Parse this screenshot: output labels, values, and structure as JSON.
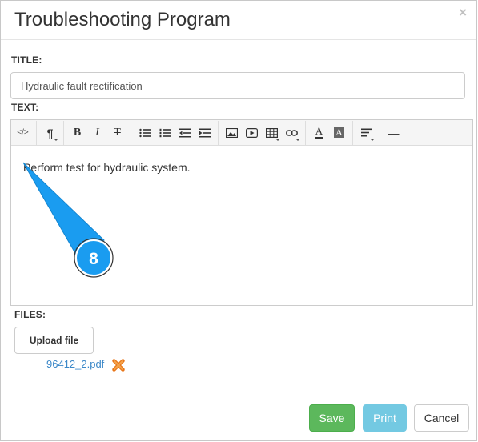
{
  "dialog": {
    "title": "Troubleshooting Program",
    "close_symbol": "×"
  },
  "form": {
    "title_label": "TITLE:",
    "title_value": "Hydraulic fault rectification",
    "text_label": "TEXT:",
    "editor_content": "Perform test for hydraulic system.",
    "files_label": "FILES:",
    "upload_label": "Upload file",
    "files": [
      {
        "name": "96412_2.pdf"
      }
    ]
  },
  "toolbar": {
    "icons": [
      "code-view-icon",
      "paragraph-icon",
      "bold-icon",
      "italic-icon",
      "strikethrough-icon",
      "unordered-list-icon",
      "ordered-list-icon",
      "outdent-icon",
      "indent-icon",
      "image-icon",
      "video-icon",
      "table-icon",
      "link-icon",
      "font-color-icon",
      "background-color-icon",
      "align-icon",
      "horizontal-rule-icon"
    ],
    "code_glyph": "</>",
    "paragraph_glyph": "¶",
    "bold_glyph": "B",
    "italic_glyph": "I",
    "strike_glyph": "T",
    "font_color_glyph": "A",
    "bg_color_glyph": "A",
    "hr_glyph": "—"
  },
  "buttons": {
    "save": "Save",
    "print": "Print",
    "cancel": "Cancel"
  },
  "callout": {
    "number": "8",
    "color": "#1a9cf0"
  }
}
